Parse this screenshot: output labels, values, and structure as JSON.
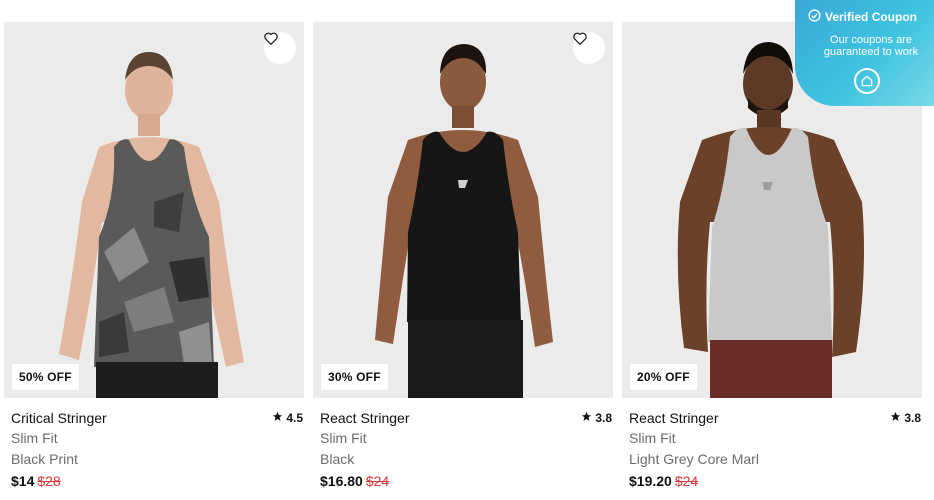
{
  "products": [
    {
      "name": "Critical Stringer",
      "fit": "Slim Fit",
      "color": "Black Print",
      "price": "$14",
      "old_price": "$28",
      "discount": "50% OFF",
      "rating": "4.5"
    },
    {
      "name": "React Stringer",
      "fit": "Slim Fit",
      "color": "Black",
      "price": "$16.80",
      "old_price": "$24",
      "discount": "30% OFF",
      "rating": "3.8"
    },
    {
      "name": "React Stringer",
      "fit": "Slim Fit",
      "color": "Light Grey Core Marl",
      "price": "$19.20",
      "old_price": "$24",
      "discount": "20% OFF",
      "rating": "3.8"
    }
  ],
  "coupon": {
    "title": "Verified Coupon",
    "subtitle": "Our coupons are guaranteed to work"
  },
  "icons": {
    "wishlist": "heart-outline-icon",
    "rating": "star-icon",
    "verified": "check-circle-icon",
    "brand": "house-logo-icon"
  },
  "colors": {
    "sale_price": "#d4363b",
    "coupon_gradient_start": "#3aa8d8",
    "coupon_gradient_end": "#79d9e7",
    "image_bg": "#ebebeb"
  }
}
